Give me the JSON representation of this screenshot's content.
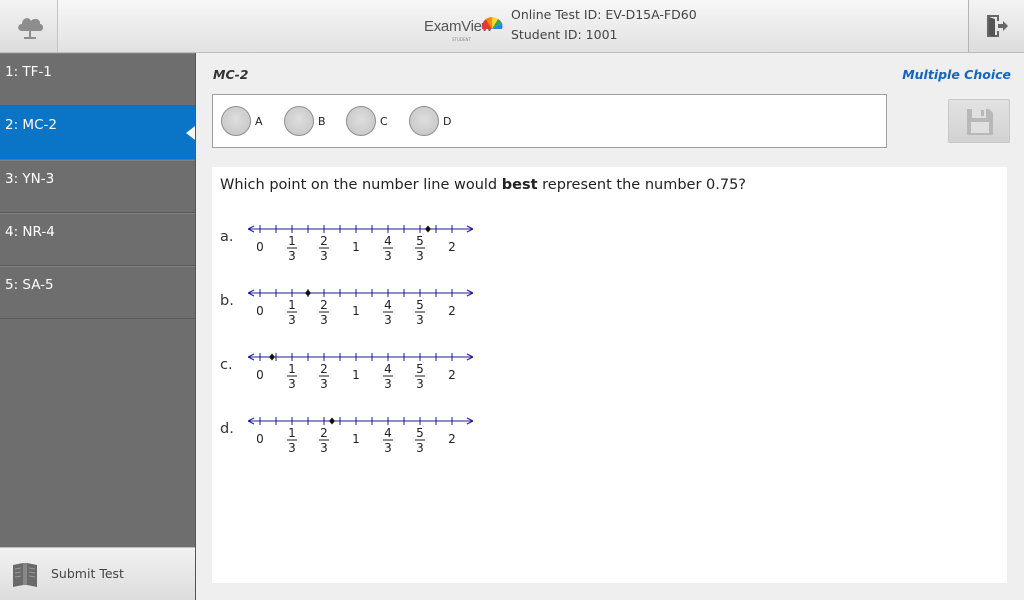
{
  "header": {
    "logo_text": "ExamView",
    "logo_sub": "STUDENT",
    "test_id": "Online Test ID: EV-D15A-FD60",
    "student_id": "Student ID: 1001",
    "left_icon": "cloud-icon",
    "right_icon": "exit-door-icon"
  },
  "sidebar": {
    "items": [
      {
        "label": "1: TF-1"
      },
      {
        "label": "2: MC-2"
      },
      {
        "label": "3: YN-3"
      },
      {
        "label": "4: NR-4"
      },
      {
        "label": "5: SA-5"
      }
    ],
    "active_index": 1,
    "submit_label": "Submit Test",
    "submit_icon": "book-icon"
  },
  "question": {
    "name": "MC-2",
    "type": "Multiple Choice",
    "choices": [
      "A",
      "B",
      "C",
      "D"
    ],
    "stem_before": "Which point on the number line would ",
    "stem_bold": "best",
    "stem_after": " represent the number 0.75?",
    "tick_labels": [
      "0",
      "1/3",
      "2/3",
      "1",
      "4/3",
      "5/3",
      "2"
    ],
    "options": [
      {
        "label": "a.",
        "point": 1.75
      },
      {
        "label": "b.",
        "point": 0.5
      },
      {
        "label": "c.",
        "point": 0.125
      },
      {
        "label": "d.",
        "point": 0.75
      }
    ]
  },
  "colors": {
    "accent": "#0a74c6",
    "sidebar": "#6e6e6e",
    "type_label": "#1565c0",
    "number_line": "#1a1aa0"
  }
}
